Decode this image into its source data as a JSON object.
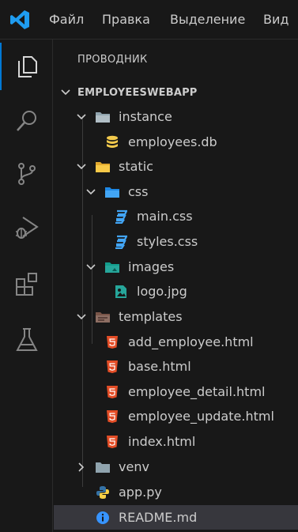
{
  "menu": {
    "file": "Файл",
    "edit": "Правка",
    "selection": "Выделение",
    "view": "Вид"
  },
  "explorer": {
    "title": "ПРОВОДНИК",
    "root": "EMPLOYEESWEBAPP",
    "items": [
      {
        "label": "instance",
        "type": "folder",
        "expanded": true
      },
      {
        "label": "employees.db",
        "type": "database"
      },
      {
        "label": "static",
        "type": "folder-static",
        "expanded": true
      },
      {
        "label": "css",
        "type": "folder-css",
        "expanded": true
      },
      {
        "label": "main.css",
        "type": "css"
      },
      {
        "label": "styles.css",
        "type": "css"
      },
      {
        "label": "images",
        "type": "folder-images",
        "expanded": true
      },
      {
        "label": "logo.jpg",
        "type": "image"
      },
      {
        "label": "templates",
        "type": "folder-templates",
        "expanded": true
      },
      {
        "label": "add_employee.html",
        "type": "html"
      },
      {
        "label": "base.html",
        "type": "html"
      },
      {
        "label": "employee_detail.html",
        "type": "html"
      },
      {
        "label": "employee_update.html",
        "type": "html"
      },
      {
        "label": "index.html",
        "type": "html"
      },
      {
        "label": "venv",
        "type": "folder",
        "expanded": false
      },
      {
        "label": "app.py",
        "type": "python"
      },
      {
        "label": "README.md",
        "type": "info",
        "selected": true
      }
    ]
  },
  "colors": {
    "accent": "#0078d4",
    "html": "#e44d26",
    "css": "#42a5f5",
    "python": "#3572a5",
    "db": "#f2c94c",
    "info": "#3794ff"
  }
}
